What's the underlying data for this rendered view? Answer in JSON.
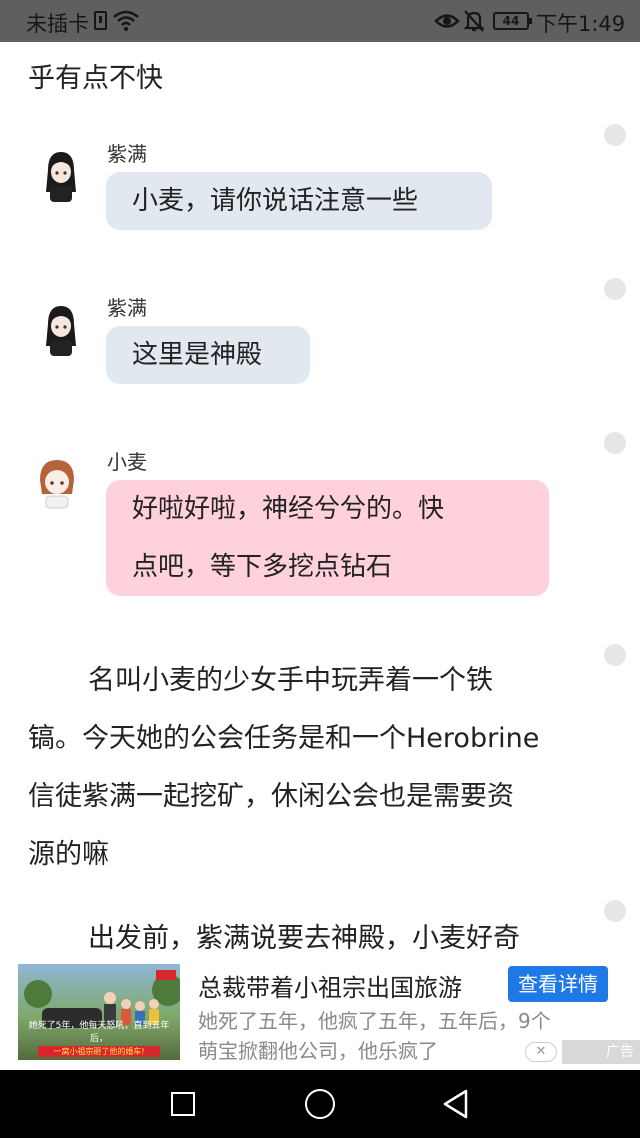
{
  "status_bar": {
    "carrier": "未插卡",
    "battery": "44",
    "time": "下午1:49"
  },
  "content": {
    "top_paragraph": "乎有点不快",
    "messages": [
      {
        "speaker": "紫满",
        "text": "小麦，请你说话注意一些",
        "style": "blue"
      },
      {
        "speaker": "紫满",
        "text": "这里是神殿",
        "style": "blue"
      },
      {
        "speaker": "小麦",
        "line1": "好啦好啦，神经兮兮的。快",
        "line2": "点吧，等下多挖点钻石",
        "style": "pink"
      }
    ],
    "narrative1": {
      "line1": "名叫小麦的少女手中玩弄着一个铁",
      "line2": "镐。今天她的公会任务是和一个Herobrine",
      "line3": "信徒紫满一起挖矿，休闲公会也是需要资",
      "line4": "源的嘛"
    },
    "narrative2": {
      "line1": "出发前，紫满说要去神殿，小麦好奇"
    }
  },
  "ad": {
    "thumb_caption": "她死了5年，他每天怒吼，直到五年后，",
    "thumb_subtitle": "一窝小祖宗砸了他的婚车!",
    "title": "总裁带着小祖宗出国旅游",
    "button": "查看详情",
    "desc_line1": "她死了五年，他疯了五年，五年后，9个",
    "desc_line2": "萌宝掀翻他公司，他乐疯了",
    "label": "广告"
  },
  "colors": {
    "bubble_blue": "#e2e8f0",
    "bubble_pink": "#ffd1dc",
    "ad_button": "#1e78e6"
  }
}
